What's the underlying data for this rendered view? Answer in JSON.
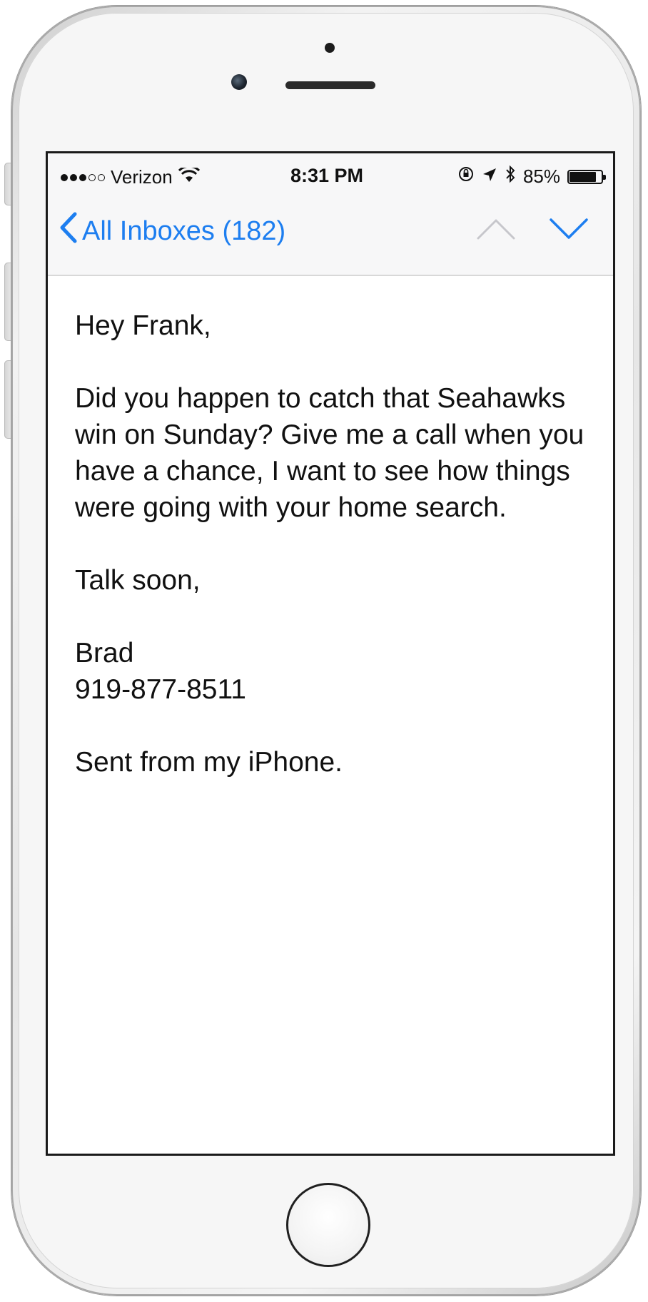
{
  "status_bar": {
    "signal_bars_filled": 3,
    "signal_bars_total": 5,
    "carrier": "Verizon",
    "wifi_icon": "wifi-icon",
    "time": "8:31 PM",
    "icons": [
      "rotation-lock-icon",
      "location-arrow-icon",
      "bluetooth-icon"
    ],
    "battery_percent_label": "85%",
    "battery_level": 0.85
  },
  "nav": {
    "back_label": "All Inboxes (182)",
    "back_icon": "chevron-left-icon",
    "prev_icon": "chevron-up-icon",
    "next_icon": "chevron-down-icon",
    "accent_color": "#1d7ef0",
    "disabled_color": "#c7c7cc"
  },
  "message": {
    "greeting": "Hey Frank,",
    "body": "Did you happen to catch that Seahawks win on Sunday? Give me a call when you have a chance, I want to see how things were going with your home search.",
    "closing": "Talk soon,",
    "signature_name": "Brad",
    "signature_phone": "919-877-8511",
    "footer": "Sent from my iPhone."
  }
}
